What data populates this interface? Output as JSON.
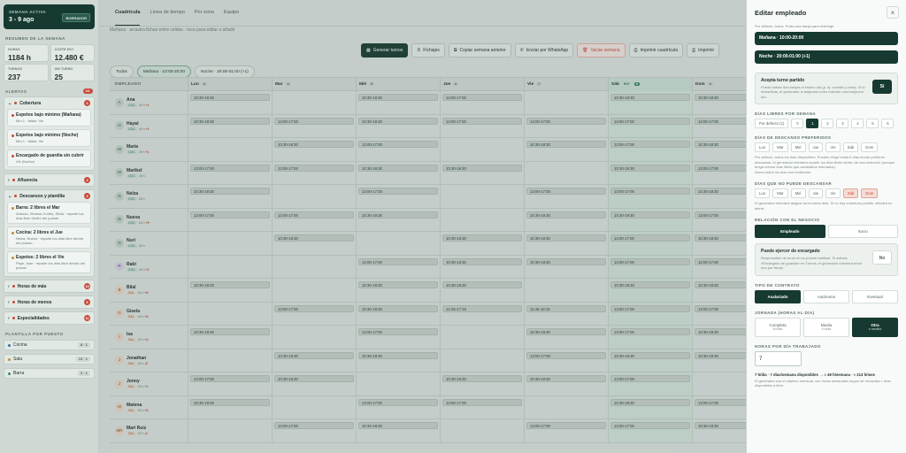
{
  "sidebar": {
    "week": {
      "label": "SEMANA ACTIVA",
      "dates": "3 - 9 ago",
      "badge": "BORRADOR"
    },
    "summary_title": "RESUMEN DE LA SEMANA",
    "stats": [
      {
        "k": "HORAS",
        "v": "1184 h"
      },
      {
        "k": "COSTE EST.",
        "v": "12.480 €"
      },
      {
        "k": "TURNOS",
        "v": "237"
      },
      {
        "k": "SIN TURNO",
        "v": "25"
      }
    ],
    "alerts_title": "ALERTAS",
    "alerts_count": "42",
    "groups": [
      {
        "label": "Cobertura",
        "count": "3",
        "color": "#c84a3a",
        "open": true,
        "items": [
          {
            "t": "Espetos bajo mínimo (Mañana)",
            "s": "Mín 1 · faltan: Vie"
          },
          {
            "t": "Espetos bajo mínimo (Noche)",
            "s": "Mín 1 · faltan: Vie"
          },
          {
            "t": "Encargado de guardia sin cubrir",
            "s": "Vie (Noche)"
          }
        ]
      },
      {
        "label": "Afluencia",
        "count": "4",
        "color": "#c84a3a",
        "open": false,
        "items": []
      },
      {
        "label": "Descansos y plantilla",
        "count": "3",
        "color": "#c84a3a",
        "open": true,
        "items": [
          {
            "t": "Barra: 2 libres el Mar",
            "s": "Antonio, Ximena Cortés, Silvia · reparte los días libre dentro del puesto"
          },
          {
            "t": "Cocina: 2 libres el Jue",
            "s": "Nelza, Nueva · reparte los días libre dentro del puesto"
          },
          {
            "t": "Espetos: 2 libres el Vie",
            "s": "Pepe, Isan · reparte los días libre dentro del puesto"
          }
        ]
      },
      {
        "label": "Horas de más",
        "count": "15",
        "color": "#c84a3a",
        "open": false,
        "items": []
      },
      {
        "label": "Horas de menos",
        "count": "6",
        "color": "#c84a3a",
        "open": false,
        "items": []
      },
      {
        "label": "Especialidades",
        "count": "11",
        "color": "#c84a3a",
        "open": false,
        "items": []
      }
    ],
    "staff_title": "PLANTILLA POR PUESTO",
    "posts": [
      {
        "n": "Cocina",
        "c": "8 · 1",
        "col": "#3a6fa0"
      },
      {
        "n": "Sala",
        "c": "15 · 1",
        "col": "#c98a34"
      },
      {
        "n": "Barra",
        "c": "3 · 1",
        "col": "#3a8a6a"
      }
    ]
  },
  "main": {
    "tabs": [
      "Cuadrícula",
      "Línea de tiempo",
      "Por zona",
      "Equipo"
    ],
    "hint": "Mañana · arrastra fichas entre celdas · toca para editar o añadir",
    "toolbar": [
      "Generar turnos",
      "Fichajes",
      "Copiar semana anterior",
      "Enviar por WhatsApp",
      "Vaciar semana",
      "Imprimir cuadrícula",
      "Imprimir"
    ],
    "filters": [
      "Todos",
      "Mañana · 10:00-20:00",
      "Noche · 20:00-01:00 (+1)"
    ],
    "col_emp": "EMPLEADO",
    "days": [
      {
        "n": "Lun",
        "d": "3"
      },
      {
        "n": "Mar",
        "d": "4"
      },
      {
        "n": "Mié",
        "d": "5"
      },
      {
        "n": "Jue",
        "d": "6"
      },
      {
        "n": "Vie",
        "d": "7"
      },
      {
        "n": "Sáb",
        "d": "8",
        "tag": "HOY"
      },
      {
        "n": "Dom",
        "d": "9"
      }
    ],
    "rows": [
      {
        "i": "A",
        "n": "Ana",
        "c": "COC",
        "h": "49 h",
        "x": "+1",
        "s": [
          "10:30-19:30",
          "",
          "10:30-19:30",
          "13:00-17:00",
          "",
          "10:30-19:30",
          "10:30-19:30"
        ]
      },
      {
        "i": "H",
        "n": "Hayat",
        "c": "COC",
        "h": "49 h",
        "x": "+1",
        "s": [
          "10:30-19:30",
          "13:00-17:00",
          "10:30-19:30",
          "13:00-17:00",
          "13:00-17:00",
          "13:00-17:00",
          "13:00-17:00"
        ]
      },
      {
        "i": "M",
        "n": "María",
        "c": "COC",
        "h": "49 h",
        "x": "+1",
        "s": [
          "",
          "10:30-19:30",
          "13:00-17:00",
          "",
          "10:30-19:30",
          "13:00-17:00",
          "10:30-19:30"
        ]
      },
      {
        "i": "M",
        "n": "Maribel",
        "c": "COC",
        "h": "45 h",
        "x": "",
        "s": [
          "13:00-17:00",
          "13:00-17:00",
          "10:30-19:30",
          "10:30-19:30",
          "",
          "10:30-19:30",
          "13:00-17:00"
        ]
      },
      {
        "i": "N",
        "n": "Nelza",
        "c": "COC",
        "h": "45 h",
        "x": "",
        "s": [
          "10:30-19:30",
          "",
          "13:00-17:00",
          "",
          "13:00-17:00",
          "13:00-17:00",
          "10:30-19:30"
        ]
      },
      {
        "i": "N",
        "n": "Nueva",
        "c": "COC",
        "h": "54 h",
        "x": "+9",
        "s": [
          "13:00-17:00",
          "13:00-17:00",
          "10:30-19:30",
          "",
          "10:30-19:30",
          "10:30-19:30",
          "13:00-17:00"
        ]
      },
      {
        "i": "N",
        "n": "Nuri",
        "c": "COC",
        "h": "45 h",
        "x": "",
        "s": [
          "",
          "10:30-19:30",
          "",
          "10:30-19:30",
          "10:30-19:30",
          "13:00-17:00",
          "10:30-19:30"
        ]
      },
      {
        "i": "R",
        "n": "Rabi",
        "c": "COC",
        "h": "49 h",
        "x": "+1",
        "s": [
          "",
          "",
          "13:00-17:00",
          "10:30-19:30",
          "10:30-19:30",
          "13:00-17:00",
          "13:00-17:00"
        ]
      },
      {
        "i": "B",
        "n": "Bilal",
        "c": "SAL",
        "h": "54 h",
        "x": "+6",
        "s": [
          "10:30-19:30",
          "",
          "10:30-19:30",
          "10:30-19:30",
          "",
          "10:30-19:30",
          "10:30-19:30"
        ]
      },
      {
        "i": "G",
        "n": "Gisela",
        "c": "SAL",
        "h": "54 h",
        "x": "+6",
        "s": [
          "",
          "13:00-17:00",
          "10:30-19:30",
          "12:45-17:15",
          "11:45-18:15",
          "13:00-17:00",
          "13:00-17:00"
        ]
      },
      {
        "i": "I",
        "n": "Isa",
        "c": "SAL",
        "h": "22 h",
        "x": "+4",
        "s": [
          "10:30-19:30",
          "",
          "13:00-17:00",
          "",
          "10:30-19:30",
          "13:00-17:00",
          "10:30-19:30"
        ]
      },
      {
        "i": "J",
        "n": "Jonathan",
        "c": "SAL",
        "h": "26 h",
        "x": "-8",
        "s": [
          "",
          "10:30-19:30",
          "10:30-19:30",
          "",
          "13:00-17:00",
          "10:30-19:30",
          "10:30-19:30"
        ]
      },
      {
        "i": "J",
        "n": "Jonny",
        "c": "SAL",
        "h": "49 h",
        "x": "+1",
        "s": [
          "13:00-17:00",
          "10:30-19:30",
          "",
          "10:30-19:30",
          "10:30-19:30",
          "13:00-17:00",
          ""
        ]
      },
      {
        "i": "M",
        "n": "Matena",
        "c": "SAL",
        "h": "54 h",
        "x": "+6",
        "s": [
          "10:30-19:30",
          "",
          "13:00-17:00",
          "13:00-17:00",
          "",
          "10:30-19:30",
          "13:00-17:00"
        ]
      },
      {
        "i": "MR",
        "n": "Mari Ruiz",
        "c": "SAL",
        "h": "42 h",
        "x": "-6",
        "s": [
          "",
          "13:00-17:00",
          "10:30-19:30",
          "",
          "13:00-17:00",
          "13:00-17:00",
          "10:30-19:30"
        ]
      }
    ]
  },
  "drawer": {
    "title": "Editar empleado",
    "top_hint": "Por defecto, todos. Pulsa una franja para restringir.",
    "shifts": [
      "Mañana · 10:00-20:00",
      "Noche · 20:00-01:00 (+1)"
    ],
    "split": {
      "t": "Acepta turno partido",
      "s": "Puede doblar dos franjas el mismo día (p. ej. comida y cena). Si lo desactivas, el generador lo asignará como máximo una franja por día.",
      "v": "Sí"
    },
    "free_days_label": "DÍAS LIBRES POR SEMANA",
    "free_days": [
      "Por defecto (1)",
      "0",
      "1",
      "2",
      "3",
      "4",
      "5",
      "6"
    ],
    "pref_label": "DÍAS DE DESCANSO PREFERIDOS",
    "week": [
      "Lun",
      "Mar",
      "Mié",
      "Jue",
      "Vie",
      "Sáb",
      "Dom"
    ],
    "pref_hint": "Por defecto, todos los días disponibles. Puedes elegir hasta 6 días donde prefieres descansar; el generador intentará repartir los días libres dentro de esa selección (aunque tenga menos días libres que candidatos marcados).",
    "pref_hint2": "Ahora todos los días son restricción.",
    "no_rest_label": "DÍAS QUE NO PUEDE DESCANSAR",
    "no_rest_hint": "El generador intentará asignar turno estos días. Si no hay cobertura posible, aflorará en alerta.",
    "rel_label": "RELACIÓN CON EL NEGOCIO",
    "rel": [
      "Empleado",
      "Socio"
    ],
    "enc": {
      "t": "Puede ejercer de encargado",
      "s": "Responsable de turno en su puesto habitual. Si activas «Encargado de guardia» en Turnos, el generador intentará tener uno por franja.",
      "v": "No"
    },
    "contract_label": "TIPO DE CONTRATO",
    "contract": [
      "Asalariado",
      "Autónomo",
      "Eventual"
    ],
    "jornada_label": "JORNADA (HORAS AL DÍA)",
    "jornada": [
      {
        "t": "Completa",
        "s": "8 h/día"
      },
      {
        "t": "Media",
        "s": "4 h/día"
      },
      {
        "t": "Otra",
        "s": "a medida"
      }
    ],
    "hours_label": "HORAS POR DÍA TRABAJADO",
    "hours_value": "7",
    "calc": "7 h/día · 7 días/semana disponibles → ≈ 49 h/semana · ≈ 213 h/mes",
    "calc_hint": "El generador usa el objetivo mensual, con horas semanales según de horas/día × días disponibles a libre."
  }
}
